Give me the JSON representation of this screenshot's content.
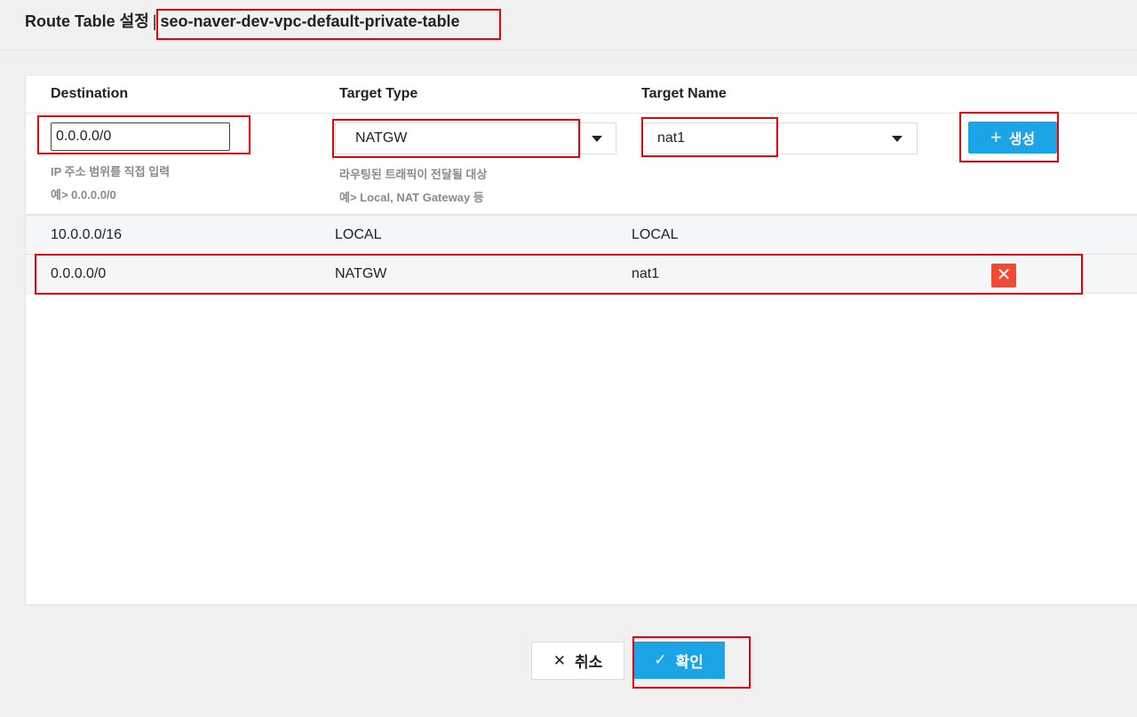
{
  "header": {
    "title": "Route Table 설정",
    "separator": "|",
    "table_name": "seo-naver-dev-vpc-default-private-table"
  },
  "columns": {
    "destination": "Destination",
    "target_type": "Target Type",
    "target_name": "Target Name"
  },
  "form": {
    "destination_value": "0.0.0.0/0",
    "destination_hint_1": "IP 주소 범위를 직접 입력",
    "destination_hint_2": "예> 0.0.0.0/0",
    "target_type_value": "NATGW",
    "target_type_hint_1": "라우팅된 트래픽이 전달될 대상",
    "target_type_hint_2": "예> Local, NAT Gateway 등",
    "target_name_value": "nat1",
    "create_label": "생성"
  },
  "routes": [
    {
      "destination": "10.0.0.0/16",
      "target_type": "LOCAL",
      "target_name": "LOCAL"
    },
    {
      "destination": "0.0.0.0/0",
      "target_type": "NATGW",
      "target_name": "nat1"
    }
  ],
  "footer": {
    "cancel_label": "취소",
    "confirm_label": "확인"
  },
  "colors": {
    "accent": "#1ba5e6",
    "delete": "#f04a34",
    "highlight": "#e8000b"
  },
  "icons": {
    "create": "plus-icon",
    "delete": "close-icon",
    "cancel": "close-icon",
    "confirm": "check-icon",
    "dropdown": "caret-down-icon"
  }
}
